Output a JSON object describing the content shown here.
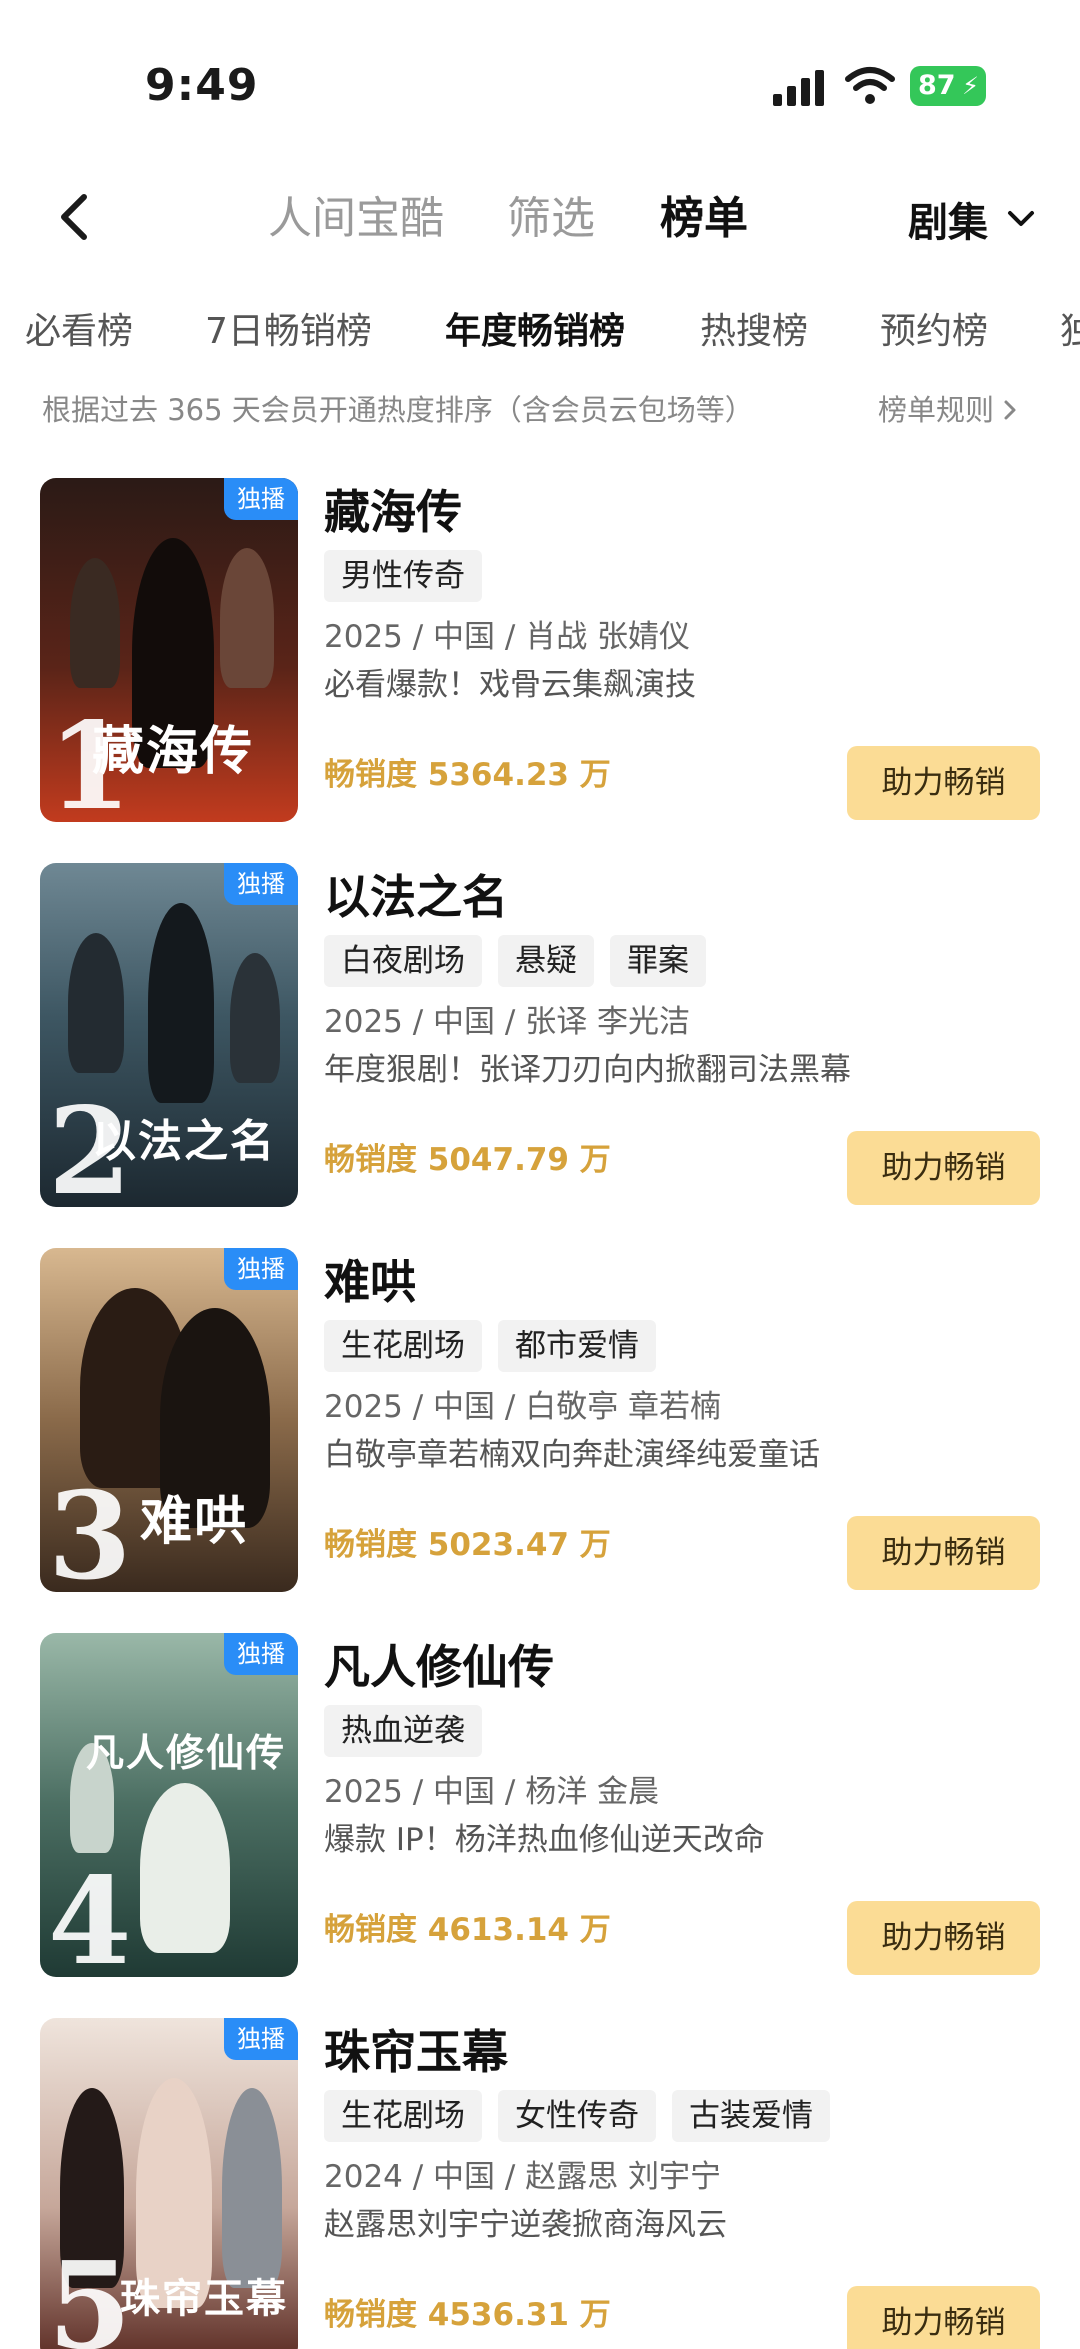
{
  "status_bar": {
    "time": "9:49",
    "battery": "87"
  },
  "nav": {
    "tabs": [
      "人间宝酷",
      "筛选",
      "榜单"
    ],
    "active_tab": "榜单",
    "category": "剧集"
  },
  "sub_tabs": [
    "必看榜",
    "7日畅销榜",
    "年度畅销榜",
    "热搜榜",
    "预约榜",
    "独"
  ],
  "active_sub_tab": "年度畅销榜",
  "description": "根据过去 365 天会员开通热度排序（含会员云包场等）",
  "rules_label": "榜单规则",
  "items": [
    {
      "rank": "1",
      "badge": "独播",
      "title": "藏海传",
      "tags": [
        "男性传奇"
      ],
      "meta": "2025 / 中国 / 肖战 张婧仪",
      "tagline": "必看爆款！戏骨云集飙演技",
      "score": "畅销度 5364.23 万",
      "button": "助力畅销",
      "poster_logo": "藏海传",
      "colors": [
        "#2b1a16",
        "#7a2a1a",
        "#c23b1e"
      ]
    },
    {
      "rank": "2",
      "badge": "独播",
      "title": "以法之名",
      "tags": [
        "白夜剧场",
        "悬疑",
        "罪案"
      ],
      "meta": "2025 / 中国 / 张译 李光洁",
      "tagline": "年度狠剧！张译刀刃向内掀翻司法黑幕",
      "score": "畅销度 5047.79 万",
      "button": "助力畅销",
      "poster_logo": "以法之名",
      "colors": [
        "#1c2830",
        "#3d5662",
        "#6f8894"
      ]
    },
    {
      "rank": "3",
      "badge": "独播",
      "title": "难哄",
      "tags": [
        "生花剧场",
        "都市爱情"
      ],
      "meta": "2025 / 中国 / 白敬亭 章若楠",
      "tagline": "白敬亭章若楠双向奔赴演绎纯爱童话",
      "score": "畅销度 5023.47 万",
      "button": "助力畅销",
      "poster_logo": "难哄",
      "colors": [
        "#3a2a1e",
        "#8a6a4a",
        "#d8b890"
      ]
    },
    {
      "rank": "4",
      "badge": "独播",
      "title": "凡人修仙传",
      "tags": [
        "热血逆袭"
      ],
      "meta": "2025 / 中国 / 杨洋 金晨",
      "tagline": "爆款 IP！杨洋热血修仙逆天改命",
      "score": "畅销度 4613.14 万",
      "button": "助力畅销",
      "poster_logo": "凡人修仙传",
      "colors": [
        "#1f3a34",
        "#4b6e62",
        "#9ab8a8"
      ]
    },
    {
      "rank": "5",
      "badge": "独播",
      "title": "珠帘玉幕",
      "tags": [
        "生花剧场",
        "女性传奇",
        "古装爱情"
      ],
      "meta": "2024 / 中国 / 赵露思 刘宇宁",
      "tagline": "赵露思刘宇宁逆袭掀商海风云",
      "score": "畅销度 4536.31 万",
      "button": "助力畅销",
      "poster_logo": "珠帘玉幕",
      "colors": [
        "#5a2a22",
        "#c6a79a",
        "#efe4dc"
      ]
    }
  ]
}
